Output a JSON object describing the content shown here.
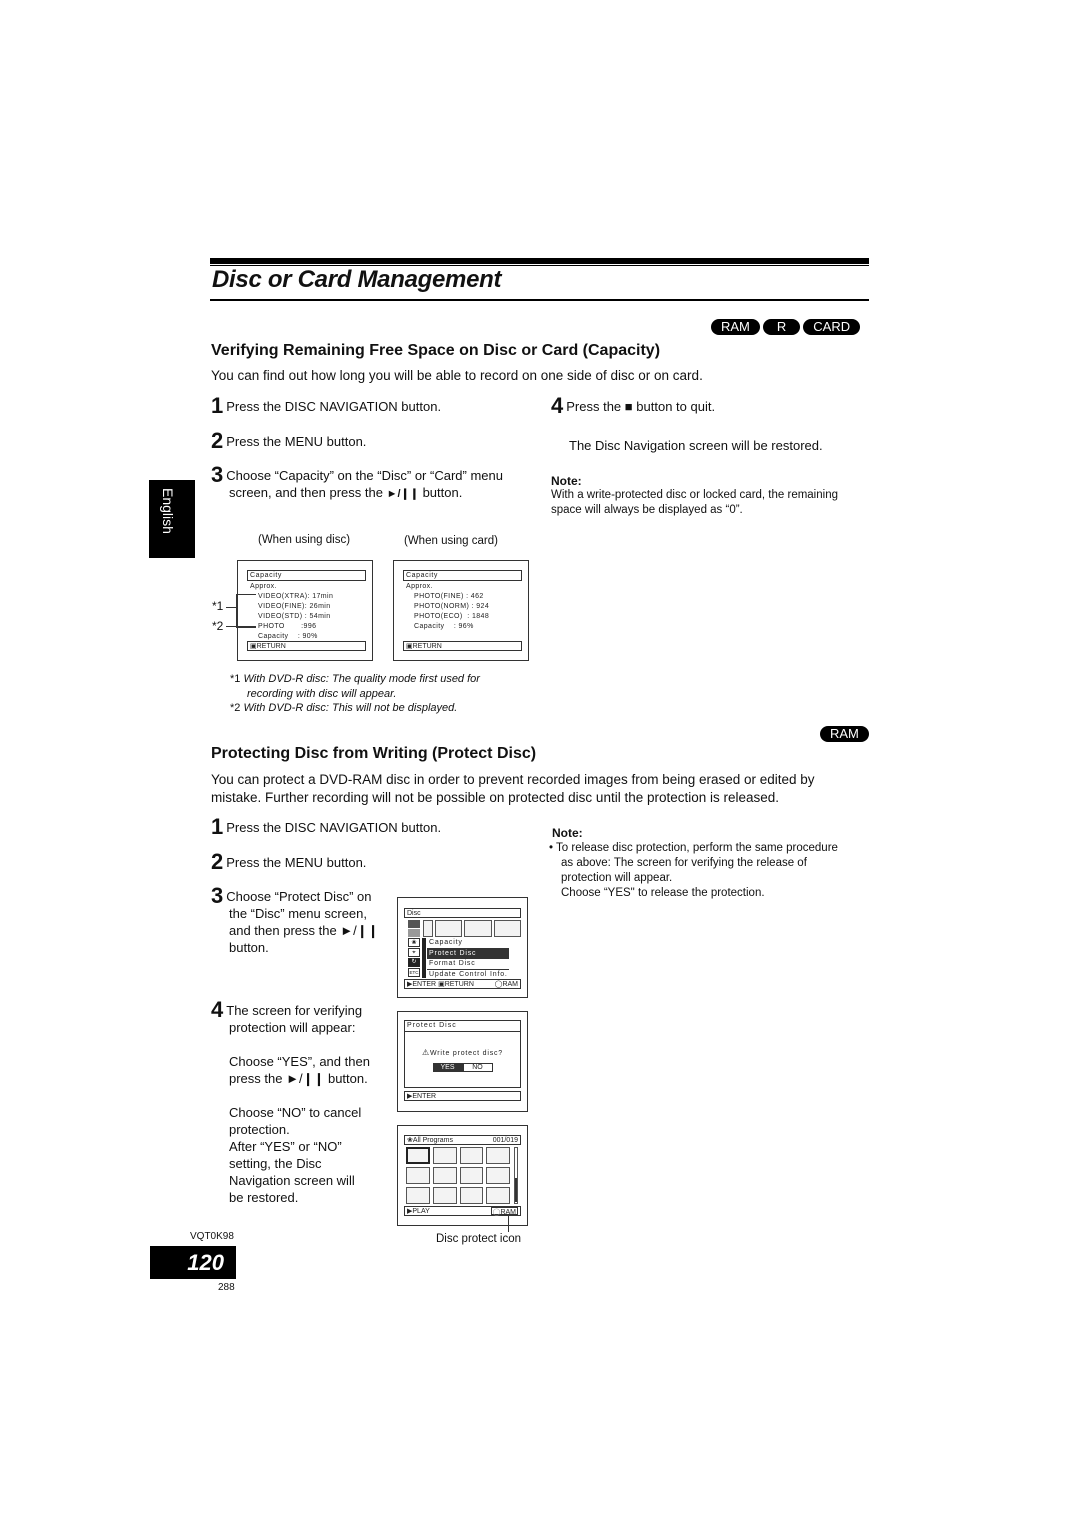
{
  "page": {
    "title": "Disc or Card Management",
    "side_tab": "English",
    "model_code": "VQT0K98",
    "page_number": "120",
    "sub_page_number": "288"
  },
  "section1": {
    "badges": [
      "RAM",
      "R",
      "CARD"
    ],
    "heading": "Verifying Remaining Free Space on Disc or Card (Capacity)",
    "intro": "You can find out how long you will be able to record on one side of disc or on card.",
    "steps": [
      {
        "num": "1",
        "text": "Press the DISC NAVIGATION button."
      },
      {
        "num": "2",
        "text": "Press the MENU button."
      },
      {
        "num": "3",
        "text_a": "Choose “Capacity” on the “Disc” or “Card” menu",
        "text_b": "screen, and then press the",
        "icon": "►/❙❙",
        "text_c": "button."
      },
      {
        "num": "4",
        "text_a": "Press the",
        "icon": "■",
        "text_b": "button to quit."
      }
    ],
    "step4_result": "The Disc Navigation screen will be restored.",
    "note_title": "Note:",
    "note_text": "With a write-protected disc or locked card, the remaining space will always be displayed as “0”.",
    "disc_screen": {
      "caption": "(When using disc)",
      "title": "Capacity",
      "approx": "Approx.",
      "rows": [
        "VIDEO(XTRA): 17min",
        "VIDEO(FINE): 26min",
        "VIDEO(STD) : 54min",
        "PHOTO       :996",
        "Capacity    : 90%"
      ],
      "return_label": "RETURN",
      "marker1": "*1",
      "marker2": "*2"
    },
    "card_screen": {
      "caption": "(When using card)",
      "title": "Capacity",
      "approx": "Approx.",
      "rows": [
        "PHOTO(FINE) : 462",
        "PHOTO(NORM) : 924",
        "PHOTO(ECO)  : 1848",
        "Capacity    : 96%"
      ],
      "return_label": "RETURN"
    },
    "footnotes": [
      {
        "mark": "*1",
        "text": "With DVD-R disc: The quality mode first used for",
        "text2": "recording with disc will appear."
      },
      {
        "mark": "*2",
        "text": "With DVD-R disc: This will not be displayed."
      }
    ]
  },
  "section2": {
    "badges": [
      "RAM"
    ],
    "heading": "Protecting Disc from Writing (Protect Disc)",
    "intro_1": "You can protect a DVD-RAM disc in order to prevent recorded images from being erased or edited by",
    "intro_2": "mistake. Further recording will not be possible on protected disc until the protection is released.",
    "steps": [
      {
        "num": "1",
        "text": "Press the DISC NAVIGATION button."
      },
      {
        "num": "2",
        "text": "Press the MENU button."
      },
      {
        "num": "3",
        "lines": [
          "Choose “Protect Disc” on",
          "the “Disc” menu screen,",
          "and then press the ►/❙❙",
          "button."
        ]
      },
      {
        "num": "4",
        "lines": [
          "The screen for verifying",
          "protection will appear:"
        ]
      }
    ],
    "step4_yes": [
      "Choose “YES”, and then",
      "press the ►/❙❙ button."
    ],
    "step4_no": [
      "Choose “NO” to cancel",
      "protection.",
      "After “YES” or “NO”",
      "setting, the Disc",
      "Navigation screen will",
      "be restored."
    ],
    "note_title": "Note:",
    "note_lines": [
      "To release disc protection, perform the same procedure",
      "as above: The screen for verifying the release of",
      "protection will appear.",
      "Choose “YES\" to release the protection."
    ],
    "menu_screen": {
      "title": "Disc",
      "items": [
        "Capacity",
        "Protect Disc",
        "Format Disc",
        "Update Control Info."
      ],
      "selected_index": 1,
      "side_icons": [
        "▤",
        "⌗",
        "◉",
        "⌕",
        "↻",
        "ETC"
      ],
      "footer_enter": "ENTER",
      "footer_return": "RETURN",
      "footer_media": "RAM"
    },
    "confirm_screen": {
      "title": "Protect Disc",
      "question": "Write protect disc?",
      "yes": "YES",
      "no": "NO",
      "footer_enter": "ENTER"
    },
    "nav_screen": {
      "title": "All Programs",
      "counter": "001/019",
      "footer_play": "PLAY",
      "footer_media": "RAM",
      "callout": "Disc protect icon"
    }
  }
}
